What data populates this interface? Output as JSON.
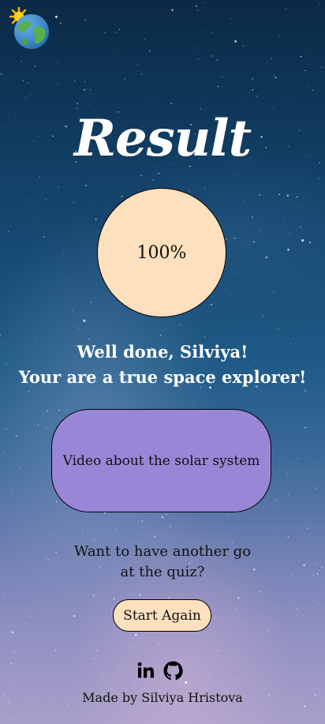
{
  "header": {
    "logo_icon": "sun-earth-icon"
  },
  "result": {
    "title": "Result",
    "score": "100%",
    "score_fraction": 1.0,
    "message_line1": "Well done, Silviya!",
    "message_line2": "Your are a true space explorer!"
  },
  "video": {
    "label": "Video about the solar system"
  },
  "retry": {
    "prompt_line1": "Want to have another go",
    "prompt_line2": "at the quiz?",
    "button_label": "Start Again"
  },
  "footer": {
    "social_icons": [
      "linkedin-icon",
      "github-icon"
    ],
    "credit": "Made by Silviya Hristova"
  },
  "colors": {
    "score_circle": "#fde0bd",
    "video_button": "#9a86d6",
    "start_button": "#fde0bd",
    "text_light": "#ffffff",
    "text_dark": "#111111"
  }
}
